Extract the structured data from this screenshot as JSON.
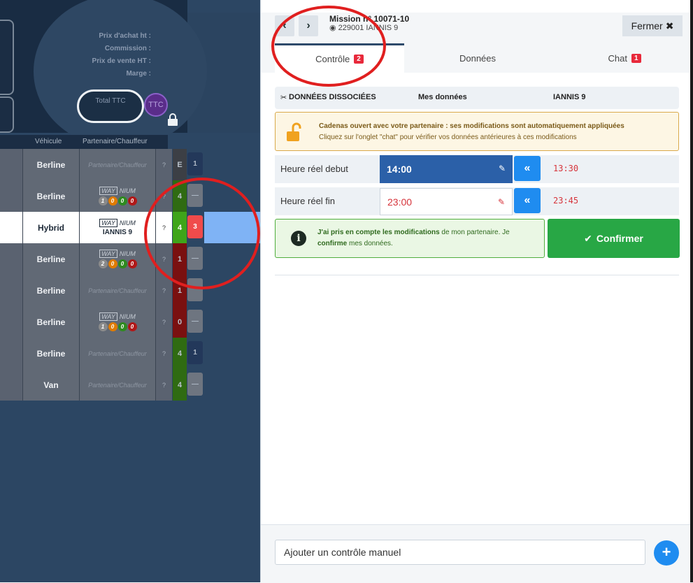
{
  "left_panel": {
    "price_labels": [
      "Prix d'achat ht :",
      "Commission :",
      "Prix de vente HT :",
      "Marge :"
    ],
    "total_ttc": "Total TTC",
    "ttc": "TTC",
    "lock_icon": "lock-icon",
    "columns": {
      "vehicle": "Véhicule",
      "partner": "Partenaire/Chauffeur"
    },
    "rows": [
      {
        "vehicle": "Berline",
        "partner_placeholder": "Partenaire/Chauffeur",
        "q": "?",
        "n1": "E",
        "n2": "1",
        "n1_color": "#3c3f45",
        "n2_color": "#23385a"
      },
      {
        "vehicle": "Berline",
        "way": "WAY",
        "nium": "NIUM",
        "dots": [
          "1",
          "0",
          "0",
          "0"
        ],
        "q": "?",
        "n1": "4",
        "n2": "—",
        "n1_color": "#2f6b12",
        "n2_color": "#6e7580"
      },
      {
        "vehicle": "Hybrid",
        "way": "WAY",
        "nium": "NIUM",
        "driver": "IANNIS 9",
        "q": "?",
        "n1": "4",
        "n2": "3",
        "n1_color": "#3fa51a",
        "n2_color": "#f04b4b"
      },
      {
        "vehicle": "Berline",
        "way": "WAY",
        "nium": "NIUM",
        "dots": [
          "2",
          "0",
          "0",
          "0"
        ],
        "q": "?",
        "n1": "1",
        "n2": "—",
        "n1_color": "#7a1010",
        "n2_color": "#6e7580"
      },
      {
        "vehicle": "Berline",
        "partner_placeholder": "Partenaire/Chauffeur",
        "q": "?",
        "n1": "1",
        "n2": "",
        "n1_color": "#7a1010",
        "n2_color": "#6e7580"
      },
      {
        "vehicle": "Berline",
        "way": "WAY",
        "nium": "NIUM",
        "dots": [
          "1",
          "0",
          "0",
          "0"
        ],
        "q": "?",
        "n1": "0",
        "n2": "—",
        "n1_color": "#7a1010",
        "n2_color": "#6e7580"
      },
      {
        "vehicle": "Berline",
        "partner_placeholder": "Partenaire/Chauffeur",
        "q": "?",
        "n1": "4",
        "n2": "1",
        "n1_color": "#2f6b12",
        "n2_color": "#23385a"
      },
      {
        "vehicle": "Van",
        "partner_placeholder": "Partenaire/Chauffeur",
        "q": "?",
        "n1": "4",
        "n2": "—",
        "n1_color": "#2f6b12",
        "n2_color": "#6e7580"
      }
    ],
    "dot_colors": [
      "#8a8a8a",
      "#e07b00",
      "#2e8a1f",
      "#b01818"
    ]
  },
  "header": {
    "prev_icon": "chevron-left-icon",
    "next_icon": "chevron-right-icon",
    "mission_title": "Mission n° 10071-10",
    "mission_sub": "229001 IANNIS 9",
    "close_label": "Fermer"
  },
  "tabs": [
    {
      "label": "Contrôle",
      "badge": "2",
      "active": true
    },
    {
      "label": "Données",
      "badge": "",
      "active": false
    },
    {
      "label": "Chat",
      "badge": "1",
      "active": false
    }
  ],
  "data_header": {
    "dissociated": "DONNÉES DISSOCIÉES",
    "mine": "Mes données",
    "partner": "IANNIS 9"
  },
  "alert": {
    "line1": "Cadenas ouvert avec votre partenaire : ses modifications sont automatiquement appliquées",
    "line2": "Cliquez sur l'onglet \"chat\" pour vérifier vos données antérieures à ces modifications"
  },
  "fields": [
    {
      "label": "Heure réel debut",
      "value": "14:00",
      "partner_value": "13:30"
    },
    {
      "label": "Heure réel fin",
      "value": "23:00",
      "partner_value": "23:45"
    }
  ],
  "confirm": {
    "text_line1_bold": "J'ai pris en compte les modifications",
    "text_line1_rest": " de mon partenaire. Je",
    "text_line2_bold": "confirme",
    "text_line2_rest": " mes données.",
    "button_label": "Confirmer"
  },
  "manual_control": {
    "placeholder": "Ajouter un contrôle manuel"
  }
}
